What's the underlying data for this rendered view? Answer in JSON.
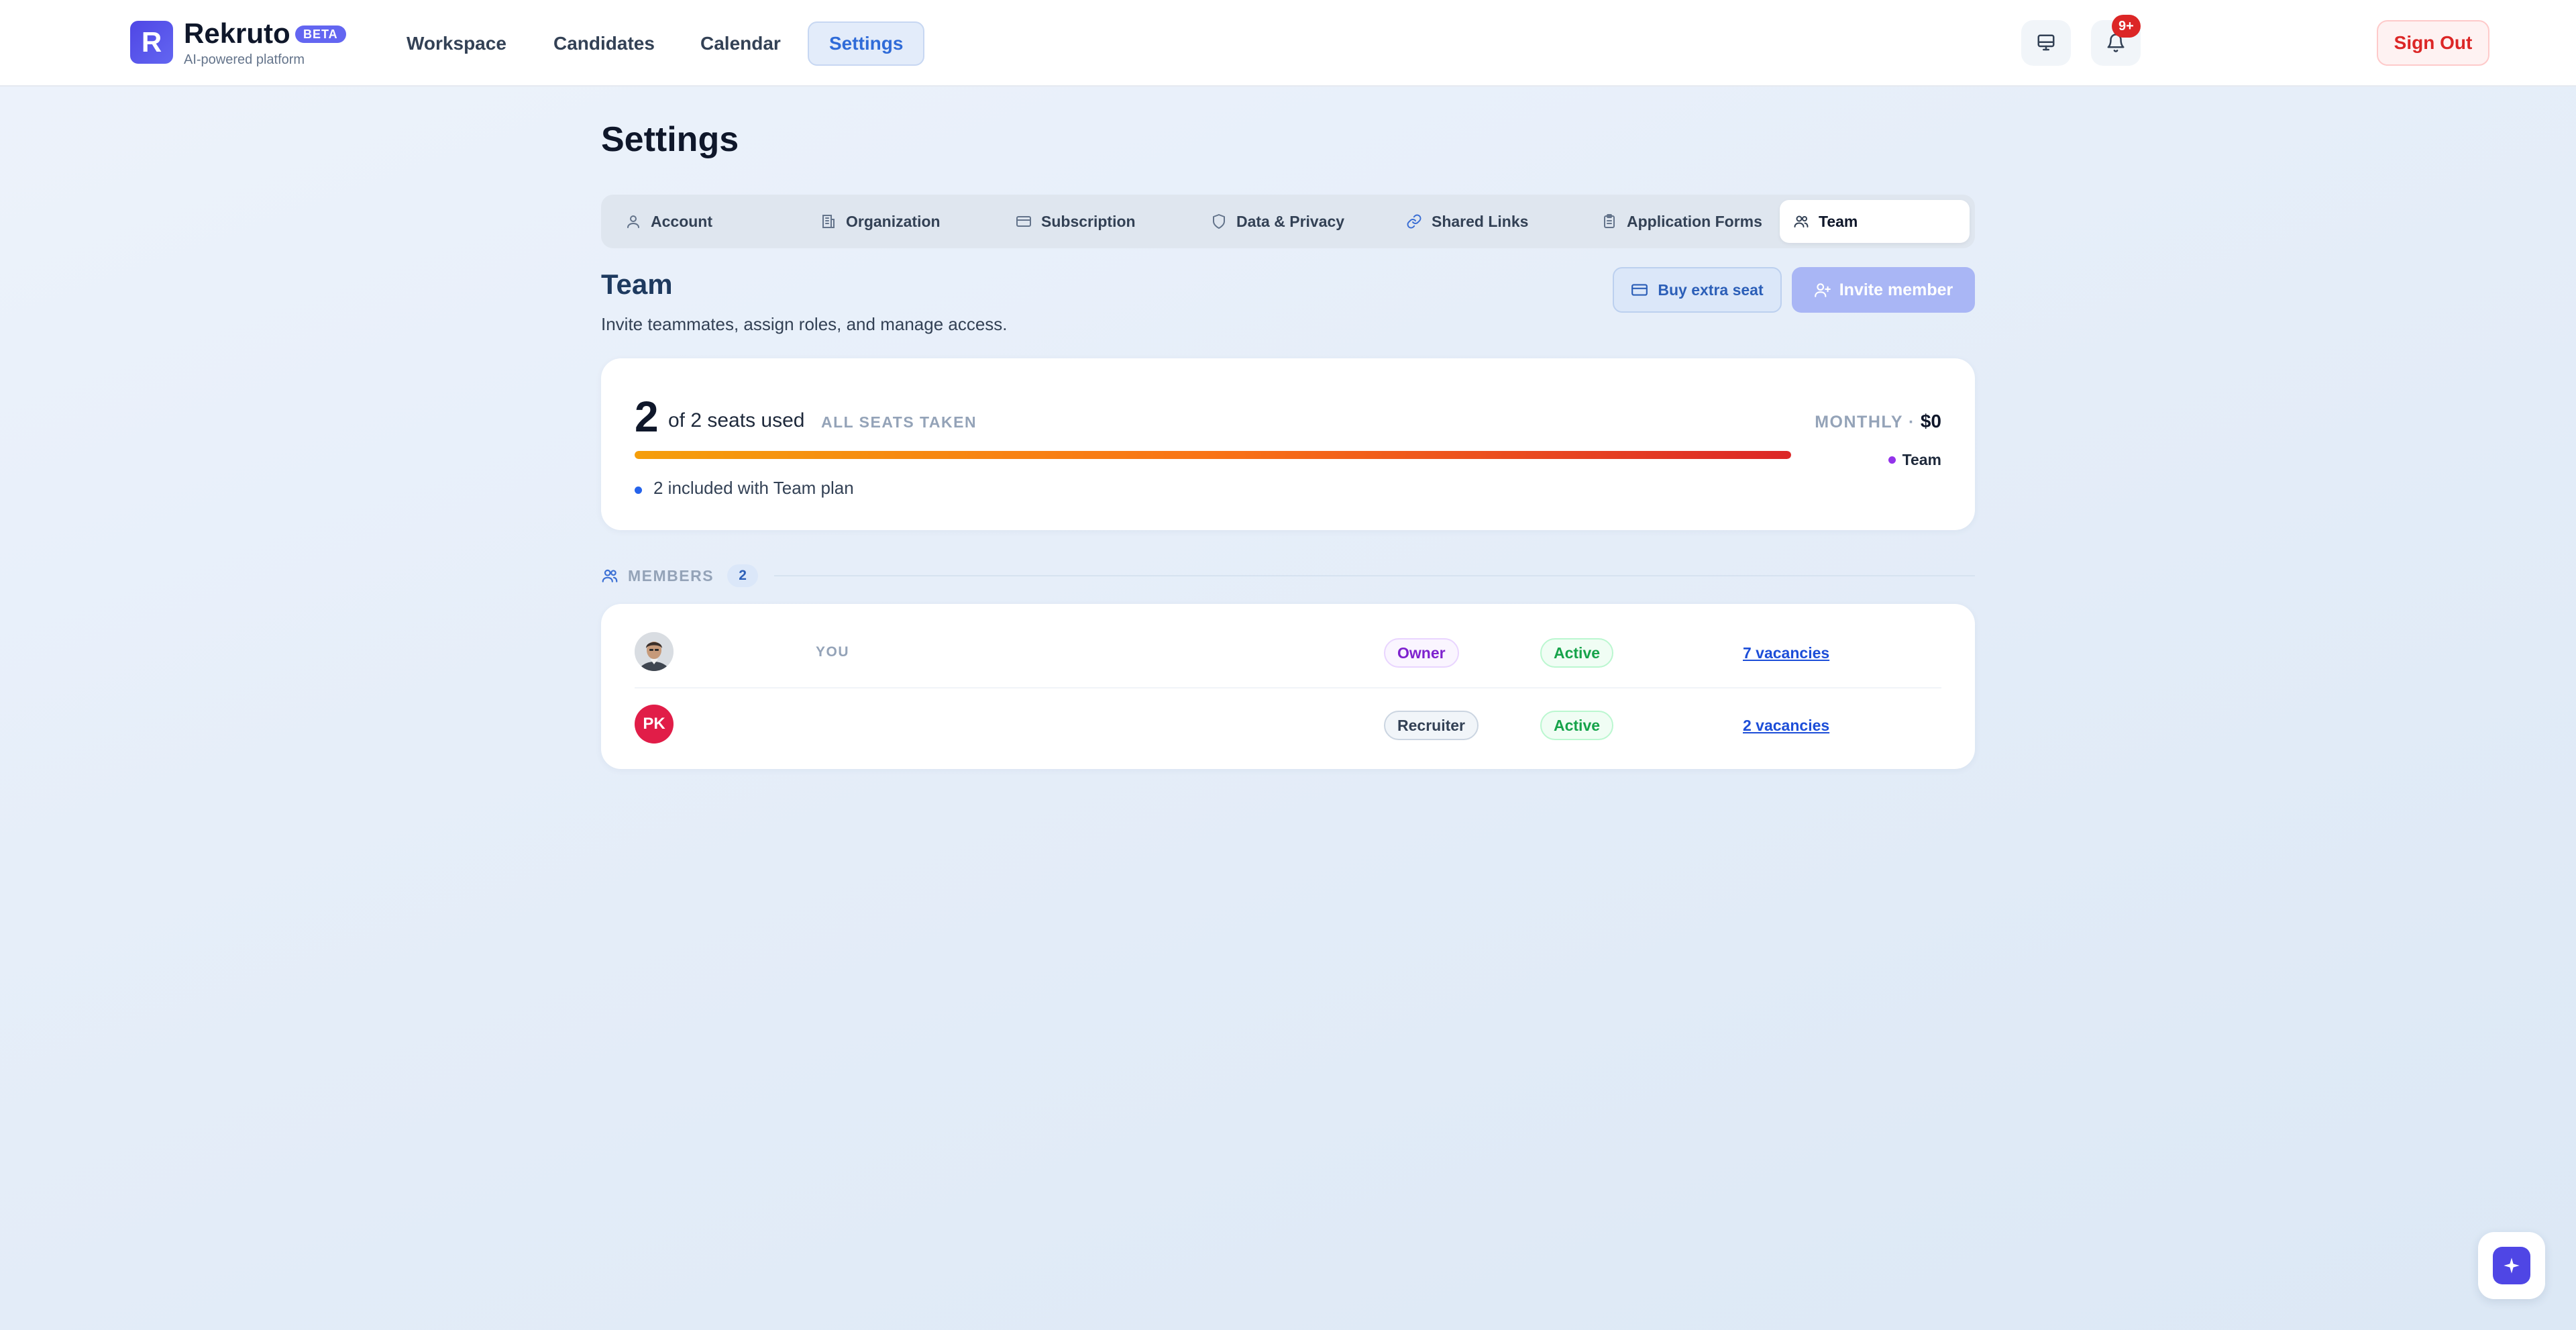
{
  "brand": {
    "logo_letter": "R",
    "name": "Rekruto",
    "badge": "BETA",
    "tagline": "AI-powered platform"
  },
  "nav": {
    "items": [
      {
        "label": "Workspace",
        "active": false
      },
      {
        "label": "Candidates",
        "active": false
      },
      {
        "label": "Calendar",
        "active": false
      },
      {
        "label": "Settings",
        "active": true
      }
    ]
  },
  "header_actions": {
    "notification_badge": "9+",
    "sign_out_label": "Sign Out"
  },
  "page": {
    "title": "Settings"
  },
  "tabs": [
    {
      "label": "Account",
      "icon": "user-icon",
      "active": false
    },
    {
      "label": "Organization",
      "icon": "building-icon",
      "active": false
    },
    {
      "label": "Subscription",
      "icon": "credit-card-icon",
      "active": false
    },
    {
      "label": "Data & Privacy",
      "icon": "shield-icon",
      "active": false
    },
    {
      "label": "Shared Links",
      "icon": "link-icon",
      "active": false
    },
    {
      "label": "Application Forms",
      "icon": "clipboard-icon",
      "active": false
    },
    {
      "label": "Team",
      "icon": "users-icon",
      "active": true
    }
  ],
  "team": {
    "title": "Team",
    "description": "Invite teammates, assign roles, and manage access.",
    "buy_seat_label": "Buy extra seat",
    "invite_label": "Invite member"
  },
  "seats": {
    "used": "2",
    "used_text": "of 2 seats used",
    "status": "ALL SEATS TAKEN",
    "usage_fraction": 1.0,
    "included_text": "2 included with Team plan",
    "monthly_label": "MONTHLY ·",
    "monthly_value": "$0",
    "plan_name": "Team",
    "colors": {
      "progress_start": "#f59e0b",
      "progress_end": "#dc2626",
      "plan_dot": "#9333ea"
    }
  },
  "members": {
    "label": "MEMBERS",
    "count": "2",
    "rows": [
      {
        "avatar_type": "photo",
        "initials": "",
        "tag": "YOU",
        "role": "Owner",
        "status": "Active",
        "vacancies": "7 vacancies"
      },
      {
        "avatar_type": "initials",
        "initials": "PK",
        "tag": "",
        "role": "Recruiter",
        "status": "Active",
        "vacancies": "2 vacancies"
      }
    ]
  }
}
